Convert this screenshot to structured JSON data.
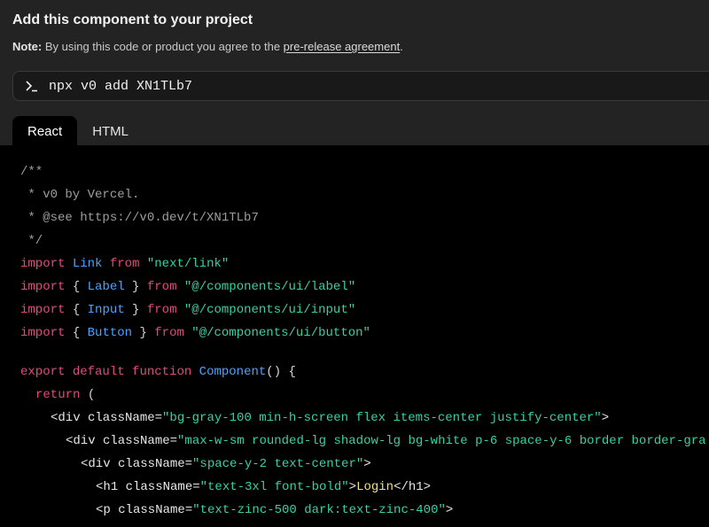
{
  "header": {
    "title": "Add this component to your project",
    "note_label": "Note:",
    "note_text": " By using this code or product you agree to the ",
    "note_link": "pre-release agreement",
    "note_end": "."
  },
  "command": {
    "text": "npx v0 add XN1TLb7"
  },
  "tabs": [
    {
      "label": "React",
      "active": true
    },
    {
      "label": "HTML",
      "active": false
    }
  ],
  "code": {
    "l1": "/**",
    "l2": " * v0 by Vercel.",
    "l3": " * @see https://v0.dev/t/XN1TLb7",
    "l4": " */",
    "l5": [
      "import",
      " ",
      "Link",
      " ",
      "from",
      " ",
      "\"next/link\""
    ],
    "l6": [
      "import",
      " { ",
      "Label",
      " } ",
      "from",
      " ",
      "\"@/components/ui/label\""
    ],
    "l7": [
      "import",
      " { ",
      "Input",
      " } ",
      "from",
      " ",
      "\"@/components/ui/input\""
    ],
    "l8": [
      "import",
      " { ",
      "Button",
      " } ",
      "from",
      " ",
      "\"@/components/ui/button\""
    ],
    "l9": [
      "export",
      " ",
      "default",
      " ",
      "function",
      " ",
      "Component",
      "() {"
    ],
    "l10": [
      "return",
      " ("
    ],
    "l11": [
      "<div className=",
      "\"bg-gray-100 min-h-screen flex items-center justify-center\"",
      ">"
    ],
    "l12": [
      "<div className=",
      "\"max-w-sm rounded-lg shadow-lg bg-white p-6 space-y-6 border border-gra"
    ],
    "l13": [
      "<div className=",
      "\"space-y-2 text-center\"",
      ">"
    ],
    "l14": [
      "<h1 className=",
      "\"text-3xl font-bold\"",
      ">",
      "Login",
      "</h1>"
    ],
    "l15": [
      "<p className=",
      "\"text-zinc-500 dark:text-zinc-400\"",
      ">"
    ]
  }
}
